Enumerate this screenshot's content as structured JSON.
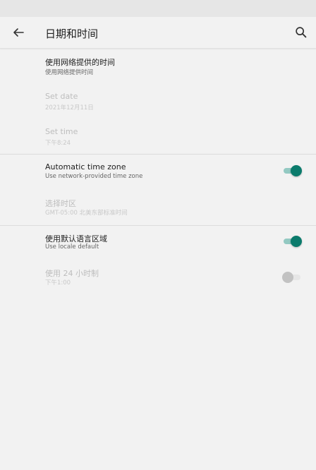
{
  "header": {
    "title": "日期和时间",
    "back_icon": "back-arrow-icon",
    "search_icon": "search-icon"
  },
  "settings": {
    "network_time": {
      "title": "使用网络提供的时间",
      "summary": "使用网络提供时间"
    },
    "set_date": {
      "title": "Set date",
      "summary": "2021年12月11日"
    },
    "set_time": {
      "title": "Set time",
      "summary": "下午8:24"
    },
    "auto_timezone": {
      "title": "Automatic time zone",
      "summary": "Use network-provided time zone",
      "enabled": true
    },
    "select_timezone": {
      "title": "选择时区",
      "summary": "GMT-05:00 北美东部标准时间"
    },
    "locale_default": {
      "title": "使用默认语言区域",
      "summary": "Use locale default",
      "enabled": true
    },
    "use_24h": {
      "title": "使用 24 小时制",
      "summary": "下午1:00",
      "enabled": false
    }
  },
  "colors": {
    "accent": "#0b7b6c",
    "accent_track": "#93c9c2"
  }
}
